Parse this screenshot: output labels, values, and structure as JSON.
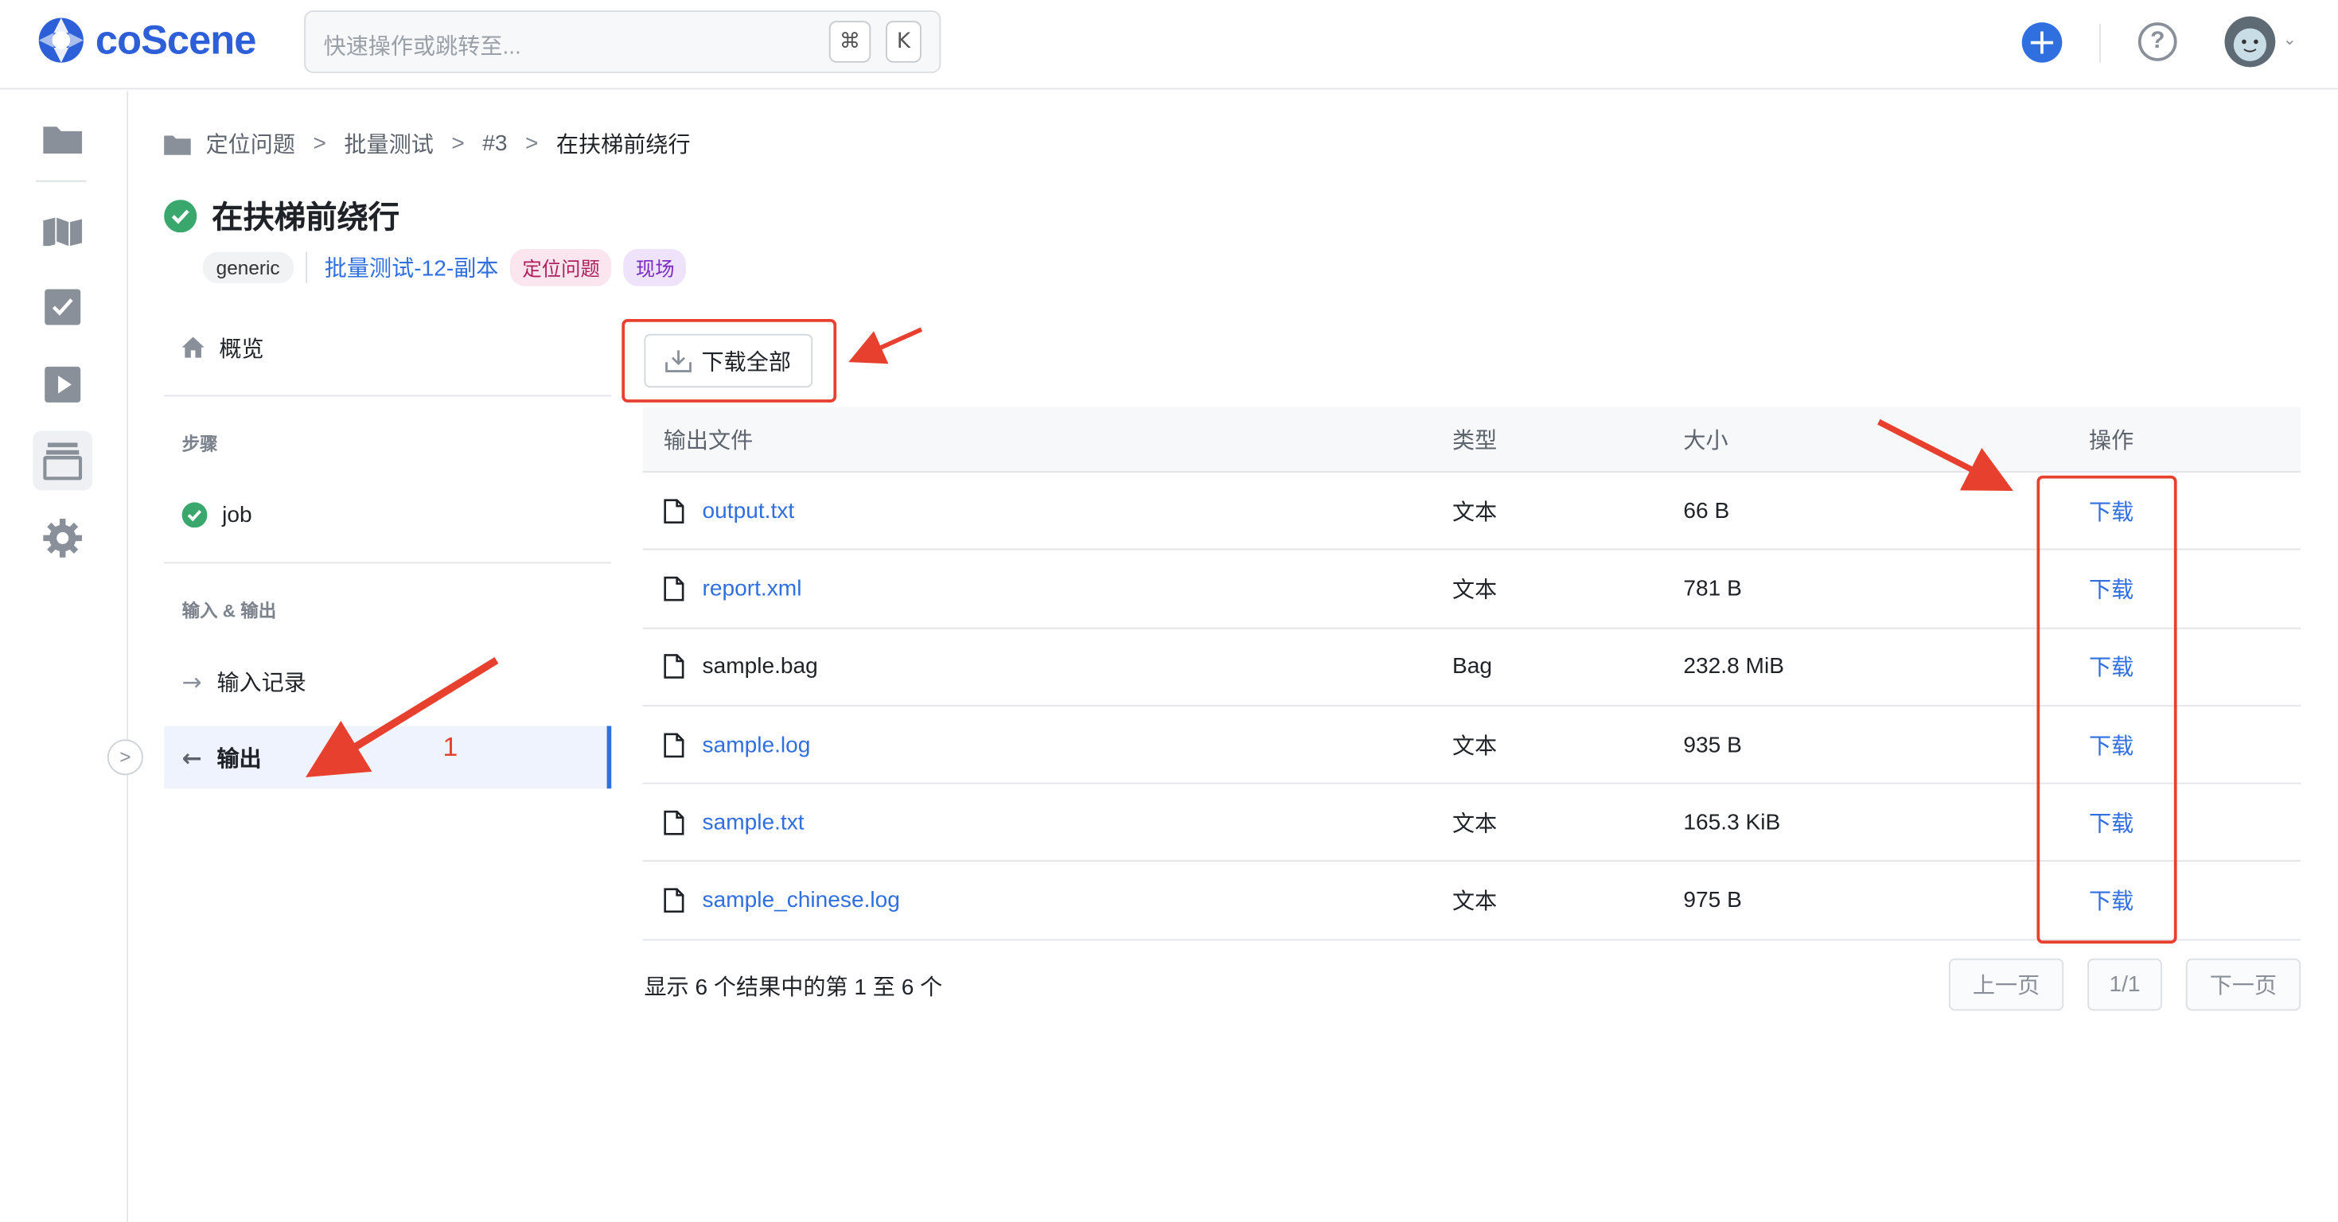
{
  "header": {
    "brand": "coScene",
    "search_placeholder": "快速操作或跳转至...",
    "shortcut_cmd": "⌘",
    "shortcut_key": "K",
    "plus_icon": "plus-circle-icon",
    "help_icon": "question-circle-icon",
    "accent": "#2f6fe0"
  },
  "breadcrumb": [
    "定位问题",
    "批量测试",
    "#3",
    "在扶梯前绕行"
  ],
  "record": {
    "title": "在扶梯前绕行",
    "status": "success",
    "tags": {
      "type": "generic",
      "source": "批量测试-12-副本",
      "label1": "定位问题",
      "label2": "现场"
    }
  },
  "nav": {
    "overview": "概览",
    "steps_header": "步骤",
    "step_job": "job",
    "io_header": "输入 & 输出",
    "input_records": "输入记录",
    "output": "输出"
  },
  "main": {
    "download_all": "下载全部",
    "columns": [
      "输出文件",
      "类型",
      "大小",
      "操作"
    ],
    "rows": [
      {
        "name": "output.txt",
        "type": "文本",
        "size": "66 B",
        "action": "下载",
        "linked": true
      },
      {
        "name": "report.xml",
        "type": "文本",
        "size": "781 B",
        "action": "下载",
        "linked": true
      },
      {
        "name": "sample.bag",
        "type": "Bag",
        "size": "232.8 MiB",
        "action": "下载",
        "linked": false
      },
      {
        "name": "sample.log",
        "type": "文本",
        "size": "935 B",
        "action": "下载",
        "linked": true
      },
      {
        "name": "sample.txt",
        "type": "文本",
        "size": "165.3 KiB",
        "action": "下载",
        "linked": true
      },
      {
        "name": "sample_chinese.log",
        "type": "文本",
        "size": "975 B",
        "action": "下载",
        "linked": true
      }
    ],
    "summary": "显示 6 个结果中的第 1 至 6 个",
    "pagination": {
      "prev": "上一页",
      "page": "1/1",
      "next": "下一页"
    }
  },
  "annotation": {
    "number": "1",
    "color": "#e8402f"
  }
}
